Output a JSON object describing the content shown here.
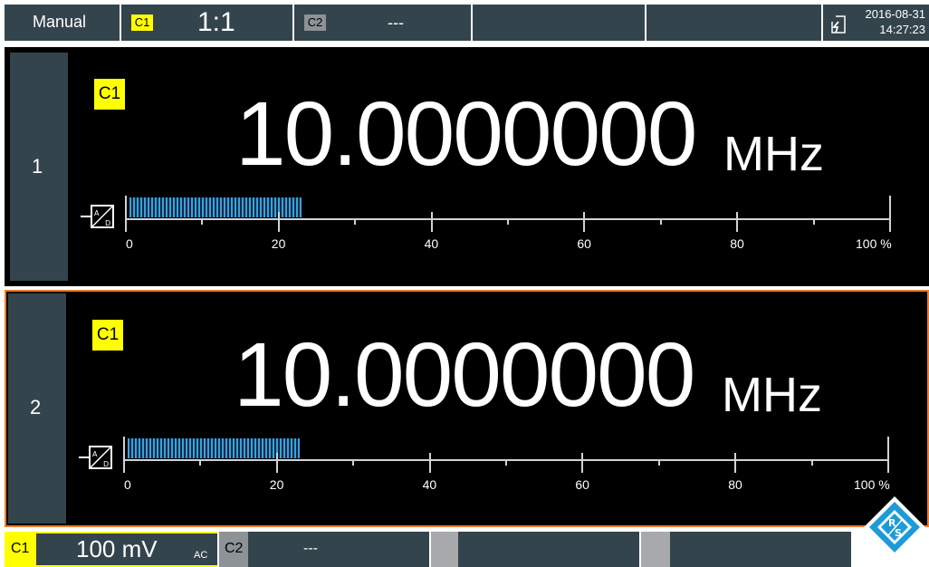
{
  "top_bar": {
    "mode": "Manual",
    "channel1": {
      "tag": "C1",
      "ratio": "1:1"
    },
    "channel2": {
      "tag": "C2",
      "value": "---"
    },
    "date": "2016-08-31",
    "time": "14:27:23",
    "power_icon": "battery-charging-icon"
  },
  "panels": [
    {
      "number": "1",
      "channel_tag": "C1",
      "value": "10.0000000",
      "unit": "MHz",
      "adc_icon": "adc-converter-icon",
      "level_fraction": 0.23,
      "scale": [
        "0",
        "20",
        "40",
        "60",
        "80",
        "100 %"
      ],
      "selected": false
    },
    {
      "number": "2",
      "channel_tag": "C1",
      "value": "10.0000000",
      "unit": "MHz",
      "adc_icon": "adc-converter-icon",
      "level_fraction": 0.23,
      "scale": [
        "0",
        "20",
        "40",
        "60",
        "80",
        "100 %"
      ],
      "selected": true
    }
  ],
  "bottom_bar": {
    "channel1": {
      "tag": "C1",
      "scale": "100 mV",
      "coupling": "AC"
    },
    "channel2": {
      "tag": "C2",
      "value": "---"
    }
  },
  "colors": {
    "accent_yellow": "#ffff00",
    "bar_gray": "#34444d",
    "selection_orange": "#ee7d2b",
    "level_blue": "#3aa0e0"
  },
  "brand_logo": "rohde-schwarz-logo"
}
